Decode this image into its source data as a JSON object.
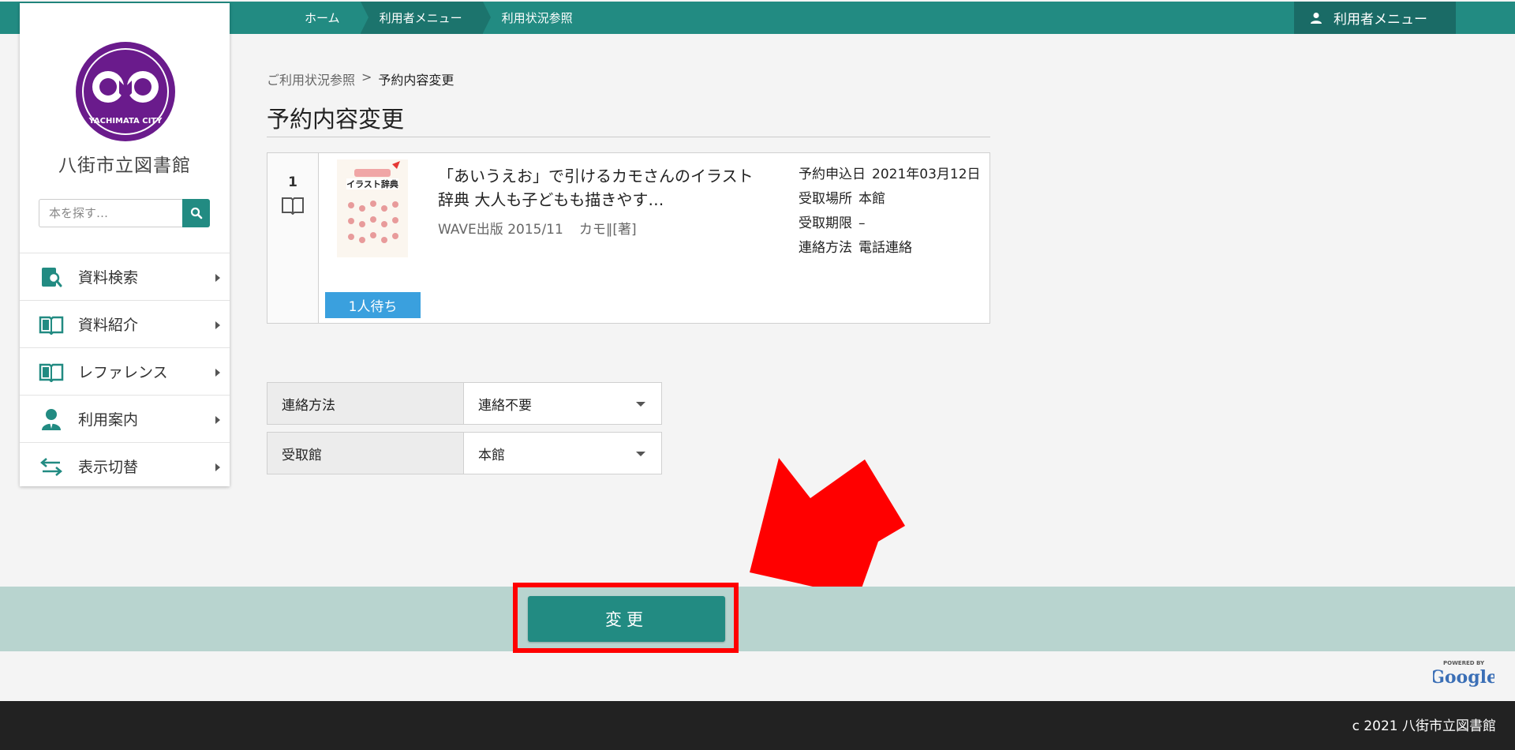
{
  "topbar": {
    "crumbs": [
      "ホーム",
      "利用者メニュー",
      "利用状況参照"
    ],
    "user_menu_label": "利用者メニュー"
  },
  "sidebar": {
    "logo_text": "YACHIMATA CITY",
    "library_name": "八街市立図書館",
    "search": {
      "placeholder": "本を探す…",
      "value": ""
    },
    "items": [
      {
        "label": "資料検索",
        "icon": "search-book-icon"
      },
      {
        "label": "資料紹介",
        "icon": "open-book-icon"
      },
      {
        "label": "レファレンス",
        "icon": "open-book-icon"
      },
      {
        "label": "利用案内",
        "icon": "person-icon"
      },
      {
        "label": "表示切替",
        "icon": "swap-arrows-icon"
      }
    ]
  },
  "breadcrumb": {
    "parent": "ご利用状況参照",
    "separator": ">",
    "current": "予約内容変更"
  },
  "page_title": "予約内容変更",
  "item": {
    "number": "1",
    "title": "「あいうえお」で引けるカモさんのイラスト辞典 大人も子どもも描きやす…",
    "publisher": "WAVE出版 2015/11",
    "author": "カモ∥[著]",
    "details": [
      {
        "label": "予約申込日",
        "value": "2021年03月12日"
      },
      {
        "label": "受取場所",
        "value": "本館"
      },
      {
        "label": "受取期限",
        "value": "–"
      },
      {
        "label": "連絡方法",
        "value": "電話連絡"
      }
    ],
    "wait_badge": "1人待ち",
    "cover_text": "イラスト辞典"
  },
  "form": {
    "contact": {
      "label": "連絡方法",
      "value": "連絡不要"
    },
    "pickup": {
      "label": "受取館",
      "value": "本館"
    }
  },
  "action": {
    "change_label": "変更"
  },
  "google_badge": {
    "top": "POWERED BY",
    "name": "Google"
  },
  "footer": {
    "copyright": "c 2021 八街市立図書館"
  },
  "colors": {
    "teal": "#228b82",
    "band": "#b8d4cf",
    "highlight": "#ff0000",
    "badge": "#3aa0de"
  }
}
